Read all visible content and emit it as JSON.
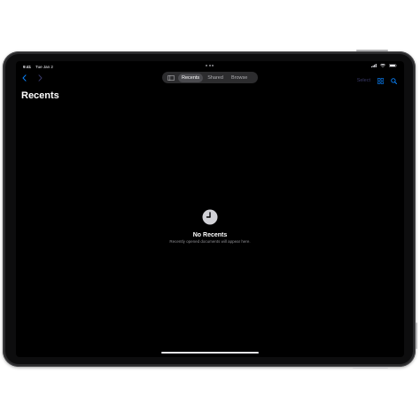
{
  "status_bar": {
    "time": "9:41",
    "date": "Tue Jan 2"
  },
  "nav": {
    "back_icon": "chevron-left-icon",
    "forward_icon": "chevron-right-icon"
  },
  "tabs": [
    {
      "label": "Recents",
      "active": true
    },
    {
      "label": "Shared",
      "active": false
    },
    {
      "label": "Browse",
      "active": false
    }
  ],
  "toolbar": {
    "select_label": "Select"
  },
  "page": {
    "title": "Recents"
  },
  "empty_state": {
    "icon": "clock-icon",
    "title": "No Recents",
    "subtitle": "Recently opened documents will appear here."
  },
  "colors": {
    "accent": "#0a84ff",
    "screen_bg": "#000000",
    "frame": "#2a2a2c"
  }
}
